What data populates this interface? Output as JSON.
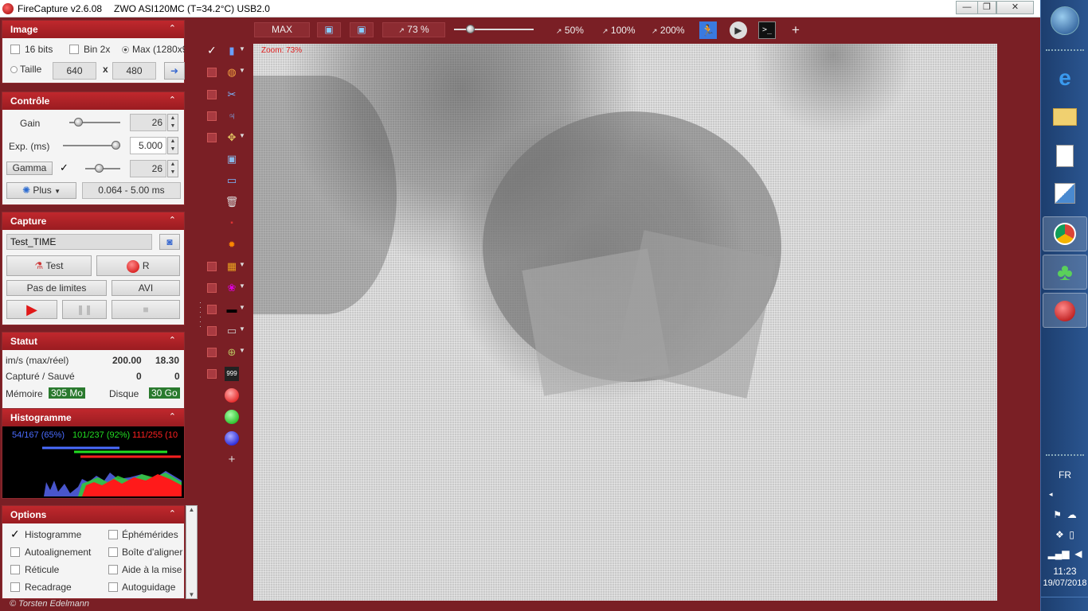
{
  "window": {
    "title": "FireCapture v2.6.08",
    "camera": "ZWO ASI120MC (T=34.2°C) USB2.0",
    "minimize": "—",
    "restore": "❐",
    "close": "✕"
  },
  "image_panel": {
    "title": "Image",
    "bits_label": "16 bits",
    "bin_label": "Bin 2x",
    "max_label": "Max (1280x9",
    "taille_label": "Taille",
    "width": "640",
    "x": "x",
    "height": "480",
    "go": "➜"
  },
  "controle_panel": {
    "title": "Contrôle",
    "gain_label": "Gain",
    "gain_value": "26",
    "exp_label": "Exp. (ms)",
    "exp_value": "5.000",
    "gamma_label": "Gamma",
    "gamma_value": "26",
    "plus_label": "Plus",
    "range": "0.064 - 5.00 ms",
    "gain_level": 0.12,
    "exp_level": 1.0,
    "gamma_level": 0.35
  },
  "capture_panel": {
    "title": "Capture",
    "profile": "Test_TIME",
    "test_label": "Test",
    "r_label": "R",
    "limit_label": "Pas de limites",
    "format_label": "AVI"
  },
  "statut_panel": {
    "title": "Statut",
    "fps_label": "im/s (max/réel)",
    "fps_max": "200.00",
    "fps_real": "18.30",
    "saved_label": "Capturé / Sauvé",
    "captured": "0",
    "saved": "0",
    "mem_label": "Mémoire",
    "mem_value": "305 Mo",
    "disk_label": "Disque",
    "disk_value": "30 Go"
  },
  "histo_panel": {
    "title": "Histogramme",
    "blue_stat": "54/167 (65%)",
    "green_stat": "101/237 (92%)",
    "red_stat": "111/255 (10",
    "colors": {
      "blue": "#4a6cff",
      "green": "#22dd22",
      "red": "#ff2020"
    }
  },
  "options_panel": {
    "title": "Options",
    "items": [
      "Histogramme",
      "Éphémérides",
      "Autoalignement",
      "Boîte d'aligner",
      "Réticule",
      "Aide à la mise",
      "Recadrage",
      "Autoguidage"
    ]
  },
  "footer": "© Torsten Edelmann",
  "topbar": {
    "max": "MAX",
    "zoom_value": "73 %",
    "z50": "50%",
    "z100": "100%",
    "z200": "200%",
    "plus": "+"
  },
  "preview": {
    "zoom_tag": "Zoom: 73%"
  },
  "tools": {
    "add": "+"
  },
  "taskbar": {
    "lang": "FR",
    "time": "11:23",
    "date": "19/07/2018"
  }
}
